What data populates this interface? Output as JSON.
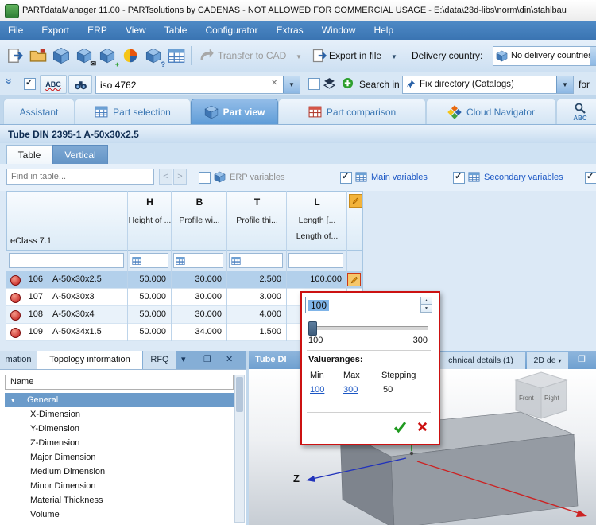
{
  "window": {
    "title": "PARTdataManager 11.00 - PARTsolutions by CADENAS - NOT ALLOWED FOR COMMERCIAL USAGE - E:\\data\\23d-libs\\norm\\din\\stahlbau"
  },
  "menu": {
    "items": [
      "File",
      "Export",
      "ERP",
      "View",
      "Table",
      "Configurator",
      "Extras",
      "Window",
      "Help"
    ]
  },
  "toolbar": {
    "transfer_to_cad": "Transfer to CAD",
    "export_in_file": "Export in file",
    "delivery_country_label": "Delivery country:",
    "delivery_country_value": "No delivery countries"
  },
  "search_row": {
    "spell_label": "ABC",
    "query": "iso 4762",
    "search_in_label": "Search in",
    "directory": "Fix directory (Catalogs)",
    "for_label": "for"
  },
  "main_tabs": {
    "assistant": "Assistant",
    "part_selection": "Part selection",
    "part_view": "Part view",
    "part_comparison": "Part comparison",
    "cloud_navigator": "Cloud Navigator",
    "search_abc": "ABC"
  },
  "part_panel": {
    "title": "Tube DIN 2395-1 A-50x30x2.5",
    "tab_table": "Table",
    "tab_vertical": "Vertical",
    "find_placeholder": "Find in table...",
    "erp_variables_label": "ERP variables",
    "main_variables_label": "Main variables",
    "secondary_variables_label": "Secondary variables",
    "eclass_label": "eClass 7.1",
    "columns": {
      "h": {
        "letter": "H",
        "desc": "Height of ..."
      },
      "b": {
        "letter": "B",
        "desc": "Profile wi..."
      },
      "t": {
        "letter": "T",
        "desc": "Profile thi..."
      },
      "l": {
        "letter": "L",
        "desc": "Length [...",
        "desc2": "Length of..."
      }
    },
    "rows": [
      {
        "id": "106",
        "name": "A-50x30x2.5",
        "h": "50.000",
        "b": "30.000",
        "t": "2.500",
        "l": "100.000"
      },
      {
        "id": "107",
        "name": "A-50x30x3",
        "h": "50.000",
        "b": "30.000",
        "t": "3.000"
      },
      {
        "id": "108",
        "name": "A-50x30x4",
        "h": "50.000",
        "b": "30.000",
        "t": "4.000"
      },
      {
        "id": "109",
        "name": "A-50x34x1.5",
        "h": "50.000",
        "b": "34.000",
        "t": "1.500"
      }
    ]
  },
  "value_popup": {
    "value": "100",
    "range_min": "100",
    "range_max": "300",
    "valueranges_label": "Valueranges:",
    "min_header": "Min",
    "max_header": "Max",
    "stepping_header": "Stepping",
    "min_value": "100",
    "max_value": "300",
    "stepping_value": "50"
  },
  "topology_panel": {
    "tab_information": "mation",
    "tab_topology": "Topology information",
    "tab_rfq": "RFQ",
    "name_header": "Name",
    "group": "General",
    "items": [
      "X-Dimension",
      "Y-Dimension",
      "Z-Dimension",
      "Major Dimension",
      "Medium Dimension",
      "Minor Dimension",
      "Material Thickness",
      "Volume"
    ]
  },
  "preview_panel": {
    "title": "Tube DI",
    "tab_technical": "chnical details (1)",
    "tab_2d": "2D de",
    "axis_label": "Z",
    "cube_front": "Front",
    "cube_right": "Right"
  }
}
